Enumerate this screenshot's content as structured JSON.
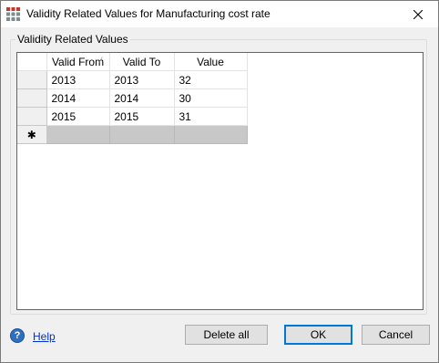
{
  "window": {
    "title": "Validity Related Values for Manufacturing cost rate",
    "close_glyph": "✕"
  },
  "group": {
    "label": "Validity Related Values"
  },
  "grid": {
    "columns": [
      "Valid From",
      "Valid To",
      "Value"
    ],
    "rows": [
      [
        "2013",
        "2013",
        "32"
      ],
      [
        "2014",
        "2014",
        "30"
      ],
      [
        "2015",
        "2015",
        "31"
      ]
    ],
    "new_row_marker": "✱",
    "sort_indicator": "⁄"
  },
  "footer": {
    "help_icon": "?",
    "help_label": "Help",
    "delete_all_label": "Delete all",
    "ok_label": "OK",
    "cancel_label": "Cancel"
  },
  "colors": {
    "accent": "#0078d7",
    "link": "#0033cc",
    "new_row": "#c8c8c8"
  }
}
